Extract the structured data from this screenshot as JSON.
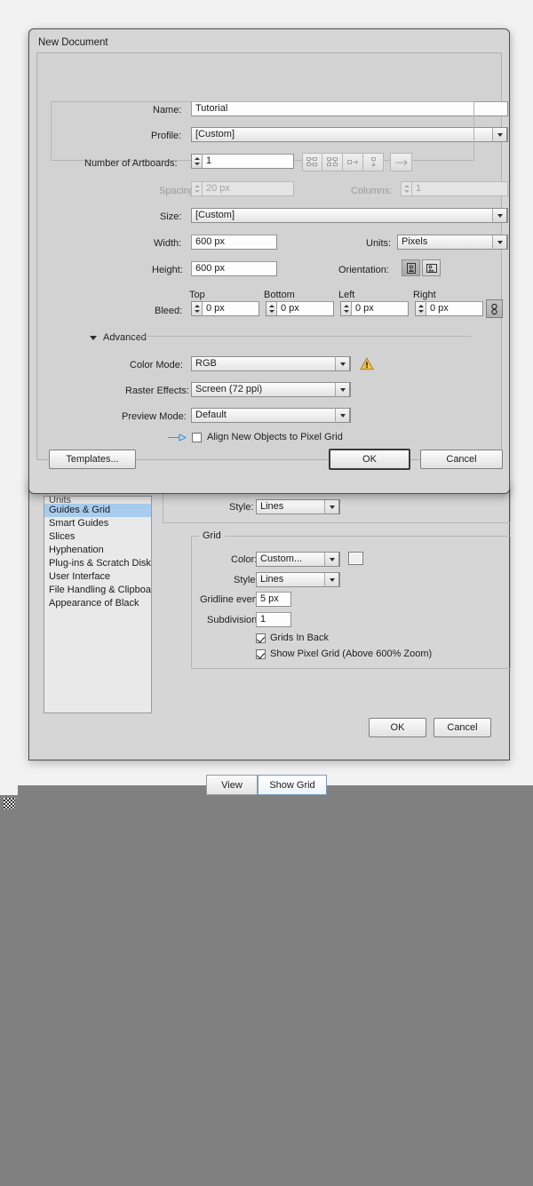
{
  "desktop": {
    "background_color": "#808080",
    "handle_icon": "resize-grip-icon"
  },
  "new_document_dialog": {
    "title": "New Document",
    "name": {
      "label": "Name:",
      "value": "Tutorial"
    },
    "profile": {
      "label": "Profile:",
      "value": "[Custom]"
    },
    "artboards": {
      "label": "Number of Artboards:",
      "value": "1",
      "layout_buttons": [
        "grid-by-row-icon",
        "grid-by-column-icon",
        "arrange-by-row-icon",
        "arrange-by-column-icon"
      ],
      "direction_button": "change-to-right-to-left-layout-icon"
    },
    "spacing": {
      "label": "Spacing:",
      "value": "20 px",
      "disabled": true
    },
    "columns": {
      "label": "Columns:",
      "value": "1",
      "disabled": true
    },
    "size": {
      "label": "Size:",
      "value": "[Custom]"
    },
    "width": {
      "label": "Width:",
      "value": "600 px"
    },
    "height": {
      "label": "Height:",
      "value": "600 px"
    },
    "units": {
      "label": "Units:",
      "value": "Pixels"
    },
    "orientation": {
      "label": "Orientation:",
      "portrait_icon": "portrait-orientation-icon",
      "landscape_icon": "landscape-orientation-icon",
      "selected": "portrait"
    },
    "bleed": {
      "label": "Bleed:",
      "top": {
        "label": "Top",
        "value": "0 px"
      },
      "bottom": {
        "label": "Bottom",
        "value": "0 px"
      },
      "left": {
        "label": "Left",
        "value": "0 px"
      },
      "right": {
        "label": "Right",
        "value": "0 px"
      },
      "link_icon": "link-bleed-values-icon"
    },
    "advanced": {
      "label": "Advanced",
      "expanded": true,
      "color_mode": {
        "label": "Color Mode:",
        "value": "RGB",
        "warning_icon": "warning-triangle-icon",
        "warning_color": "#f2c14a"
      },
      "raster_effects": {
        "label": "Raster Effects:",
        "value": "Screen (72 ppi)"
      },
      "preview_mode": {
        "label": "Preview Mode:",
        "value": "Default"
      },
      "align_pixel_grid": {
        "label": "Align New Objects to Pixel Grid",
        "checked": false,
        "arrow_icon": "pixel-grid-arrow-icon",
        "arrow_color": "#4a9ad4"
      }
    },
    "footer": {
      "templates_label": "Templates...",
      "ok_label": "OK",
      "cancel_label": "Cancel"
    }
  },
  "preferences_dialog": {
    "sidebar_items": [
      {
        "label": "Units",
        "selected": false,
        "clipped": true
      },
      {
        "label": "Guides & Grid",
        "selected": true
      },
      {
        "label": "Smart Guides",
        "selected": false
      },
      {
        "label": "Slices",
        "selected": false
      },
      {
        "label": "Hyphenation",
        "selected": false
      },
      {
        "label": "Plug-ins & Scratch Disks",
        "selected": false
      },
      {
        "label": "User Interface",
        "selected": false
      },
      {
        "label": "File Handling & Clipboard",
        "selected": false
      },
      {
        "label": "Appearance of Black",
        "selected": false
      }
    ],
    "guides_style": {
      "label": "Style:",
      "value": "Lines"
    },
    "grid": {
      "title": "Grid",
      "color": {
        "label": "Color:",
        "value": "Custom...",
        "swatch": "grid-color-swatch"
      },
      "style": {
        "label": "Style:",
        "value": "Lines"
      },
      "gridline_every": {
        "label": "Gridline every:",
        "value": "5 px"
      },
      "subdivisions": {
        "label": "Subdivisions:",
        "value": "1"
      },
      "grids_in_back": {
        "label": "Grids In Back",
        "checked": true
      },
      "show_pixel_grid": {
        "label": "Show Pixel Grid (Above 600% Zoom)",
        "checked": true
      }
    },
    "footer": {
      "ok_label": "OK",
      "cancel_label": "Cancel"
    }
  },
  "bottom_tabs": [
    {
      "label": "View",
      "active": false
    },
    {
      "label": "Show Grid",
      "active": true
    }
  ]
}
